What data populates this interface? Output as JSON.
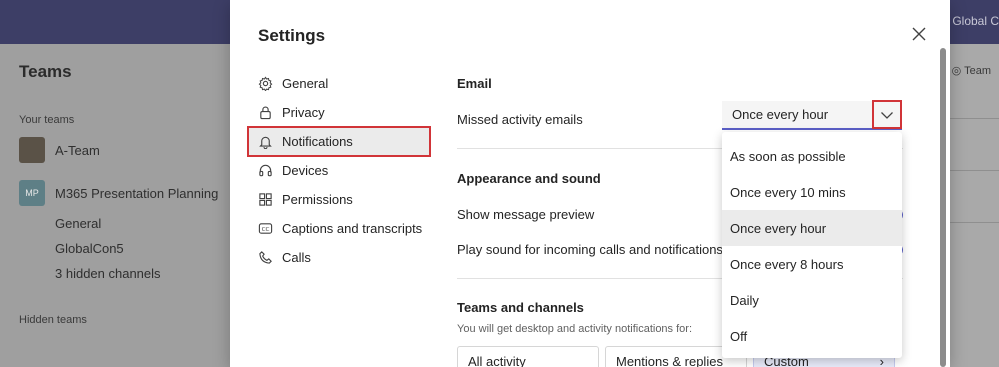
{
  "background": {
    "tenant_label": "D Global C",
    "sidebar": {
      "title": "Teams",
      "your_teams_label": "Your teams",
      "teams": [
        {
          "name": "A-Team",
          "initials": ""
        },
        {
          "name": "M365 Presentation Planning",
          "initials": "MP"
        }
      ],
      "channels": [
        "General",
        "GlobalCon5",
        "3 hidden channels"
      ],
      "hidden_teams_label": "Hidden teams"
    },
    "right_label": "Team"
  },
  "modal": {
    "title": "Settings",
    "nav": [
      {
        "label": "General",
        "icon": "gear-icon"
      },
      {
        "label": "Privacy",
        "icon": "lock-icon"
      },
      {
        "label": "Notifications",
        "icon": "bell-icon"
      },
      {
        "label": "Devices",
        "icon": "headset-icon"
      },
      {
        "label": "Permissions",
        "icon": "apps-icon"
      },
      {
        "label": "Captions and transcripts",
        "icon": "cc-icon"
      },
      {
        "label": "Calls",
        "icon": "phone-icon"
      }
    ],
    "active_nav": "Notifications",
    "email": {
      "heading": "Email",
      "missed_label": "Missed activity emails",
      "missed_value": "Once every hour"
    },
    "appearance": {
      "heading": "Appearance and sound",
      "preview_label": "Show message preview",
      "sound_label": "Play sound for incoming calls and notifications"
    },
    "teams_channels": {
      "heading": "Teams and channels",
      "note": "You will get desktop and activity notifications for:",
      "options": [
        "All activity",
        "Mentions & replies",
        "Custom"
      ]
    }
  },
  "dropdown": {
    "options": [
      "As soon as possible",
      "Once every 10 mins",
      "Once every hour",
      "Once every 8 hours",
      "Daily",
      "Off"
    ],
    "selected": "Once every hour"
  },
  "colors": {
    "accent": "#5b5fc7",
    "highlight": "#d13438",
    "topbar": "#3d3e66"
  }
}
